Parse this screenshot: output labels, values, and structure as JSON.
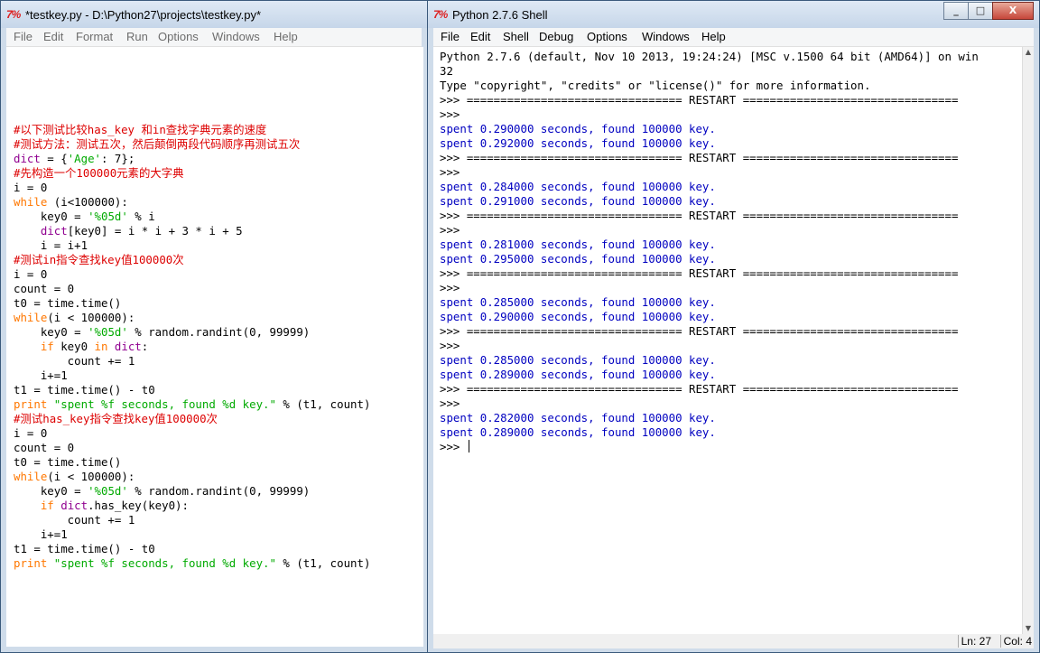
{
  "editor": {
    "title": "*testkey.py - D:\\Python27\\projects\\testkey.py*",
    "icon_text": "7%",
    "menu": [
      "File",
      "Edit",
      "Format",
      "Run",
      "Options",
      "Windows",
      "Help"
    ],
    "lines": [
      [
        {
          "c": "cm",
          "t": "#以下测试比较has_key 和in查找字典元素的速度"
        }
      ],
      [
        {
          "c": "cm",
          "t": "#测试方法：测试五次，然后颠倒两段代码顺序再测试五次"
        }
      ],
      [
        {
          "c": "bi",
          "t": "dict"
        },
        {
          "c": "nm",
          "t": " = {"
        },
        {
          "c": "st",
          "t": "'Age'"
        },
        {
          "c": "nm",
          "t": ": 7};"
        }
      ],
      [
        {
          "c": "cm",
          "t": "#先构造一个100000元素的大字典"
        }
      ],
      [
        {
          "c": "nm",
          "t": "i = 0"
        }
      ],
      [
        {
          "c": "kw",
          "t": "while"
        },
        {
          "c": "nm",
          "t": " (i<100000):"
        }
      ],
      [
        {
          "c": "nm",
          "t": "    key0 = "
        },
        {
          "c": "st",
          "t": "'%05d'"
        },
        {
          "c": "nm",
          "t": " % i"
        }
      ],
      [
        {
          "c": "nm",
          "t": "    "
        },
        {
          "c": "bi",
          "t": "dict"
        },
        {
          "c": "nm",
          "t": "[key0] = i * i + 3 * i + 5"
        }
      ],
      [
        {
          "c": "nm",
          "t": "    i = i+1"
        }
      ],
      [
        {
          "c": "cm",
          "t": "#测试in指令查找key值100000次"
        }
      ],
      [
        {
          "c": "nm",
          "t": "i = 0"
        }
      ],
      [
        {
          "c": "nm",
          "t": "count = 0"
        }
      ],
      [
        {
          "c": "nm",
          "t": "t0 = time.time()"
        }
      ],
      [
        {
          "c": "kw",
          "t": "while"
        },
        {
          "c": "nm",
          "t": "(i < 100000):"
        }
      ],
      [
        {
          "c": "nm",
          "t": "    key0 = "
        },
        {
          "c": "st",
          "t": "'%05d'"
        },
        {
          "c": "nm",
          "t": " % random.randint(0, 99999)"
        }
      ],
      [
        {
          "c": "nm",
          "t": "    "
        },
        {
          "c": "kw",
          "t": "if"
        },
        {
          "c": "nm",
          "t": " key0 "
        },
        {
          "c": "kw",
          "t": "in"
        },
        {
          "c": "nm",
          "t": " "
        },
        {
          "c": "bi",
          "t": "dict"
        },
        {
          "c": "nm",
          "t": ":"
        }
      ],
      [
        {
          "c": "nm",
          "t": "        count += 1"
        }
      ],
      [
        {
          "c": "nm",
          "t": "    i+=1"
        }
      ],
      [
        {
          "c": "nm",
          "t": "t1 = time.time() - t0"
        }
      ],
      [
        {
          "c": "kw",
          "t": "print"
        },
        {
          "c": "nm",
          "t": " "
        },
        {
          "c": "st",
          "t": "\"spent %f seconds, found %d key.\""
        },
        {
          "c": "nm",
          "t": " % (t1, count)"
        }
      ],
      [
        {
          "c": "cm",
          "t": "#测试has_key指令查找key值100000次"
        }
      ],
      [
        {
          "c": "nm",
          "t": "i = 0"
        }
      ],
      [
        {
          "c": "nm",
          "t": "count = 0"
        }
      ],
      [
        {
          "c": "nm",
          "t": "t0 = time.time()"
        }
      ],
      [
        {
          "c": "kw",
          "t": "while"
        },
        {
          "c": "nm",
          "t": "(i < 100000):"
        }
      ],
      [
        {
          "c": "nm",
          "t": "    key0 = "
        },
        {
          "c": "st",
          "t": "'%05d'"
        },
        {
          "c": "nm",
          "t": " % random.randint(0, 99999)"
        }
      ],
      [
        {
          "c": "nm",
          "t": "    "
        },
        {
          "c": "kw",
          "t": "if"
        },
        {
          "c": "nm",
          "t": " "
        },
        {
          "c": "bi",
          "t": "dict"
        },
        {
          "c": "nm",
          "t": ".has_key(key0):"
        }
      ],
      [
        {
          "c": "nm",
          "t": "        count += 1"
        }
      ],
      [
        {
          "c": "nm",
          "t": "    i+=1"
        }
      ],
      [
        {
          "c": "nm",
          "t": "t1 = time.time() - t0"
        }
      ],
      [
        {
          "c": "kw",
          "t": "print"
        },
        {
          "c": "nm",
          "t": " "
        },
        {
          "c": "st",
          "t": "\"spent %f seconds, found %d key.\""
        },
        {
          "c": "nm",
          "t": " % (t1, count)"
        }
      ]
    ]
  },
  "shell": {
    "title": "Python 2.7.6 Shell",
    "icon_text": "7%",
    "menu": [
      "File",
      "Edit",
      "Shell",
      "Debug",
      "Options",
      "Windows",
      "Help"
    ],
    "window_buttons": [
      "_",
      "□",
      "X"
    ],
    "lines": [
      [
        {
          "c": "nm",
          "t": "Python 2.7.6 (default, Nov 10 2013, 19:24:24) [MSC v.1500 64 bit (AMD64)] on win"
        }
      ],
      [
        {
          "c": "nm",
          "t": "32"
        }
      ],
      [
        {
          "c": "nm",
          "t": "Type \"copyright\", \"credits\" or \"license()\" for more information."
        }
      ],
      [
        {
          "c": "nm",
          "t": ">>> ================================ RESTART ================================"
        }
      ],
      [
        {
          "c": "nm",
          "t": ">>>"
        }
      ],
      [
        {
          "c": "out",
          "t": "spent 0.290000 seconds, found 100000 key."
        }
      ],
      [
        {
          "c": "out",
          "t": "spent 0.292000 seconds, found 100000 key."
        }
      ],
      [
        {
          "c": "nm",
          "t": ">>> ================================ RESTART ================================"
        }
      ],
      [
        {
          "c": "nm",
          "t": ">>>"
        }
      ],
      [
        {
          "c": "out",
          "t": "spent 0.284000 seconds, found 100000 key."
        }
      ],
      [
        {
          "c": "out",
          "t": "spent 0.291000 seconds, found 100000 key."
        }
      ],
      [
        {
          "c": "nm",
          "t": ">>> ================================ RESTART ================================"
        }
      ],
      [
        {
          "c": "nm",
          "t": ">>>"
        }
      ],
      [
        {
          "c": "out",
          "t": "spent 0.281000 seconds, found 100000 key."
        }
      ],
      [
        {
          "c": "out",
          "t": "spent 0.295000 seconds, found 100000 key."
        }
      ],
      [
        {
          "c": "nm",
          "t": ">>> ================================ RESTART ================================"
        }
      ],
      [
        {
          "c": "nm",
          "t": ">>>"
        }
      ],
      [
        {
          "c": "out",
          "t": "spent 0.285000 seconds, found 100000 key."
        }
      ],
      [
        {
          "c": "out",
          "t": "spent 0.290000 seconds, found 100000 key."
        }
      ],
      [
        {
          "c": "nm",
          "t": ">>> ================================ RESTART ================================"
        }
      ],
      [
        {
          "c": "nm",
          "t": ">>>"
        }
      ],
      [
        {
          "c": "out",
          "t": "spent 0.285000 seconds, found 100000 key."
        }
      ],
      [
        {
          "c": "out",
          "t": "spent 0.289000 seconds, found 100000 key."
        }
      ],
      [
        {
          "c": "nm",
          "t": ">>> ================================ RESTART ================================"
        }
      ],
      [
        {
          "c": "nm",
          "t": ">>>"
        }
      ],
      [
        {
          "c": "out",
          "t": "spent 0.282000 seconds, found 100000 key."
        }
      ],
      [
        {
          "c": "out",
          "t": "spent 0.289000 seconds, found 100000 key."
        }
      ],
      [
        {
          "c": "nm",
          "t": ">>> "
        }
      ]
    ],
    "status": {
      "line": "Ln: 27",
      "col": "Col: 4"
    }
  }
}
